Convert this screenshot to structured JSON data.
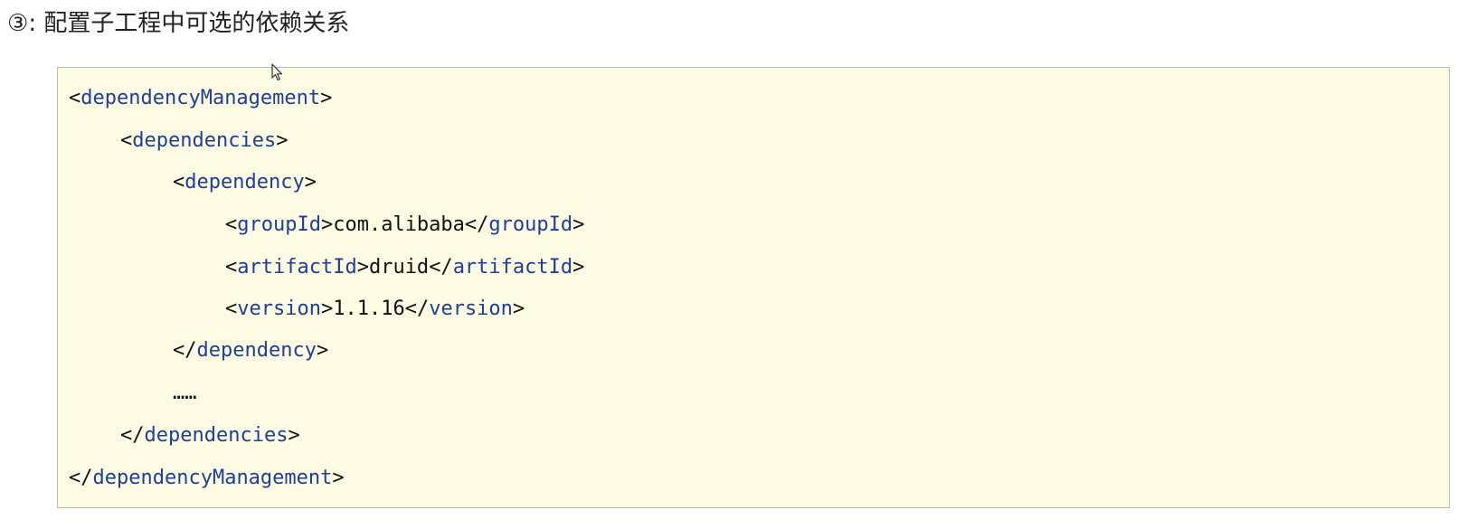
{
  "heading": {
    "marker": "③",
    "separator": ":",
    "text": "配置子工程中可选的依赖关系"
  },
  "code": {
    "lines": [
      {
        "indent": 0,
        "open": "<",
        "tag": "dependencyManagement",
        "close": ">"
      },
      {
        "indent": 1,
        "open": "<",
        "tag": "dependencies",
        "close": ">"
      },
      {
        "indent": 2,
        "open": "<",
        "tag": "dependency",
        "close": ">"
      },
      {
        "indent": 3,
        "open": "<",
        "tag": "groupId",
        "close": ">",
        "value": "com.alibaba",
        "endOpen": "</",
        "endTag": "groupId",
        "endClose": ">"
      },
      {
        "indent": 3,
        "open": "<",
        "tag": "artifactId",
        "close": ">",
        "value": "druid",
        "endOpen": "</",
        "endTag": "artifactId",
        "endClose": ">"
      },
      {
        "indent": 3,
        "open": "<",
        "tag": "version",
        "close": ">",
        "value": "1.1.16",
        "endOpen": "</",
        "endTag": "version",
        "endClose": ">"
      },
      {
        "indent": 2,
        "open": "</",
        "tag": "dependency",
        "close": ">"
      },
      {
        "indent": 2,
        "text": "……"
      },
      {
        "indent": 1,
        "open": "</",
        "tag": "dependencies",
        "close": ">"
      },
      {
        "indent": 0,
        "open": "</",
        "tag": "dependencyManagement",
        "close": ">"
      }
    ]
  }
}
